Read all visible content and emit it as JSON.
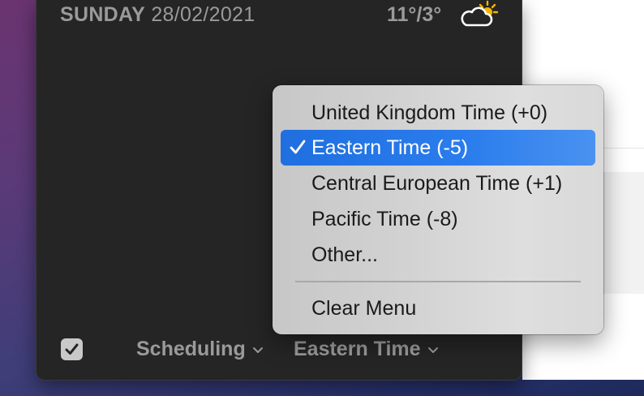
{
  "header": {
    "day": "SUNDAY",
    "date": "28/02/2021",
    "temperature": "11°/3°",
    "weather_icon": "partly-cloudy-sun-icon"
  },
  "footer": {
    "checkbox_checked": true,
    "scheduling_label": "Scheduling",
    "timezone_label": "Eastern Time"
  },
  "menu": {
    "items": [
      {
        "label": "United Kingdom Time (+0)",
        "selected": false
      },
      {
        "label": "Eastern Time (-5)",
        "selected": true
      },
      {
        "label": "Central European Time (+1)",
        "selected": false
      },
      {
        "label": "Pacific Time (-8)",
        "selected": false
      },
      {
        "label": "Other...",
        "selected": false
      }
    ],
    "clear_label": "Clear Menu"
  },
  "colors": {
    "accent": "#2b7ded",
    "widget_bg": "#252525",
    "text_muted": "#9a9a9a"
  }
}
